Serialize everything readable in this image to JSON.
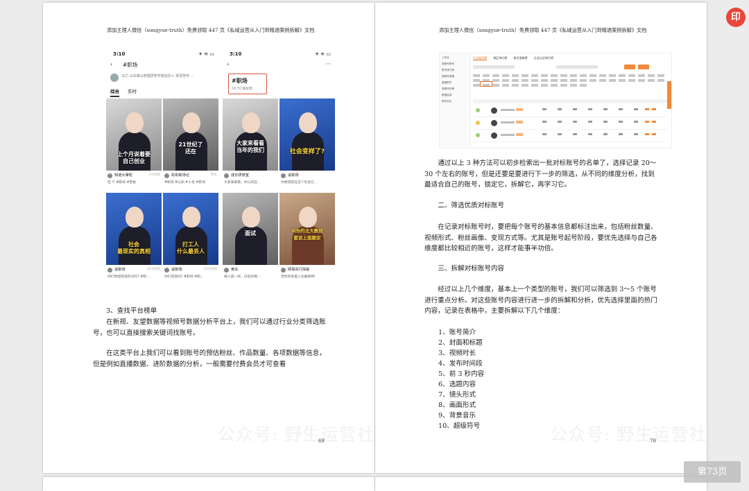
{
  "viewer": {
    "page_indicator": "第73页",
    "brand_logo_glyph": "印"
  },
  "left_page": {
    "header": "添加主理人微信（songyue-truth）免费领取 447 页《私域运营从入门到精通案例拆解》文档",
    "page_number": "69",
    "watermark": "公众号: 野生运营社区",
    "phone_a": {
      "time": "3:10",
      "status_icons": "✈ ≋ ▭",
      "back_glyph": "‹",
      "search_text": "#职场",
      "profile_line": "马力 山东泰山管理研修学院创办人 常爱陪伴 ...",
      "tabs": [
        "综合",
        "实时"
      ],
      "cells": [
        {
          "caption": "上个月说着要\n自己创业",
          "name": "知道大掌柜",
          "time": "3小时前",
          "desc": "哇 ?! #职场 #老板"
        },
        {
          "caption": "21世纪了\n还在",
          "name": "彤彤职场记",
          "time": "昨天",
          "desc": "#职场 #认知 #人性 #职场"
        },
        {
          "caption": "社会\n最现实的真相",
          "name": "说职场",
          "time": "10小时前",
          "desc": "你们觉得我说的对吗? #职..."
        },
        {
          "caption": "打工人\n什么最丢人",
          "name": "说职场",
          "time": "23小时前",
          "desc": "你们同意吗? #职场 #职..."
        }
      ]
    },
    "phone_b": {
      "time": "3:10",
      "status_icons": "✈ ≋ ▭",
      "back_glyph": "‹",
      "more_glyph": "···",
      "tag_title": "#职场",
      "tag_subtitle": "18.7亿播放量",
      "cells": [
        {
          "caption": "大家来看看\n当年的我们",
          "name": "成长研修室",
          "time": "",
          "desc": "大家来看看，你认同这..."
        },
        {
          "caption": "社会变样了?",
          "name": "说职场",
          "time": "",
          "desc": "你觉得现在这个社会已..."
        },
        {
          "caption": "面试",
          "name": "黄车",
          "time": "",
          "desc": "做人留一线，日后好相..."
        },
        {
          "caption": "叫你的北大教授\n都该上面跪安",
          "name": "网易百行探秘",
          "time": "",
          "desc": "老奶奶真是人生赢家啊!"
        }
      ]
    },
    "paragraphs": [
      "3、查找平台榜单",
      "在新视、友望数据等视频号数据分析平台上，我们可以通过行业分类筛选账号，也可以直接搜索关键词找账号。",
      "在这类平台上我们可以看到账号的预估粉丝、作品数量、各项数据等信息，但是例如直播数据、进阶数据的分析，一般需要付费会员才可查看"
    ]
  },
  "right_page": {
    "header": "添加主理人微信（songyue-truth）免费领取 447 页《私域运营从入门到精通案例拆解》文档",
    "page_number": "70",
    "watermark": "公众号: 野生运营社区",
    "dashboard": {
      "sidebar": [
        "工作台",
        "视频号账号",
        "账号排行榜",
        "视频号直播",
        "直播带货",
        "视频号热榜",
        "数据监测",
        "账号对比"
      ],
      "tabs": [
        "行业账号榜",
        "地区排行榜",
        "账号涨粉榜",
        "企业认证排行榜"
      ]
    },
    "paragraphs": [
      "通过以上 3 种方法可以初步检索出一批对标账号的名单了，选择记录 20～30 个左右的账号，但是还要是要进行下一步的筛选，从不同的维度分析，找到最适合自己的账号，锁定它，拆解它，再学习它。",
      "二、筛选优质对标账号",
      "在记录对标账号时，要把每个账号的基本信息都标注出来，包括粉丝数量、视频形式、粉丝画像、变现方式等。尤其是账号起号阶段，要优先选择与自己各维度都比较相近的账号，这样才能事半功倍。",
      "三、拆解对标账号内容",
      "经过以上几个维度，基本上一个类型的账号，我们可以筛选到 3～5 个账号进行重点分析。对这些账号内容进行进一步的拆解和分析，优先选择里面的热门内容，记录在表格中，主要拆解以下几个维度："
    ],
    "list_items": [
      "1、账号简介",
      "2、封面和标题",
      "3、视频时长",
      "4、发布时间段",
      "5、前 3 秒内容",
      "6、选题内容",
      "7、镜头形式",
      "8、画面形式",
      "9、背景音乐",
      "10、超级符号"
    ]
  }
}
